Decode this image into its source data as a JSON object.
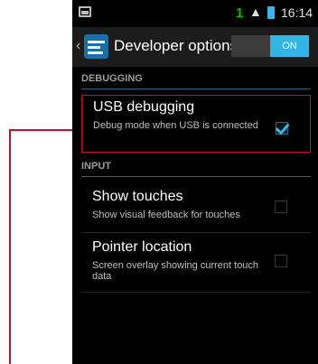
{
  "status_bar": {
    "notification_badge": "1",
    "clock": "16:14",
    "signal_icon": "signal-icon",
    "battery_icon": "battery-icon"
  },
  "action_bar": {
    "title": "Developer options",
    "toggle_label": "ON",
    "accent_color": "#33b5e5"
  },
  "sections": [
    {
      "header": "DEBUGGING",
      "items": [
        {
          "title": "USB debugging",
          "summary": "Debug mode when USB is connected",
          "checked": true
        }
      ]
    },
    {
      "header": "INPUT",
      "items": [
        {
          "title": "Show touches",
          "summary": "Show visual feedback for touches",
          "checked": false
        },
        {
          "title": "Pointer location",
          "summary": "Screen overlay showing current touch data",
          "checked": false
        }
      ]
    }
  ],
  "annotation": {
    "highlight_color": "#c8102e",
    "highlighted_item": "USB debugging"
  }
}
